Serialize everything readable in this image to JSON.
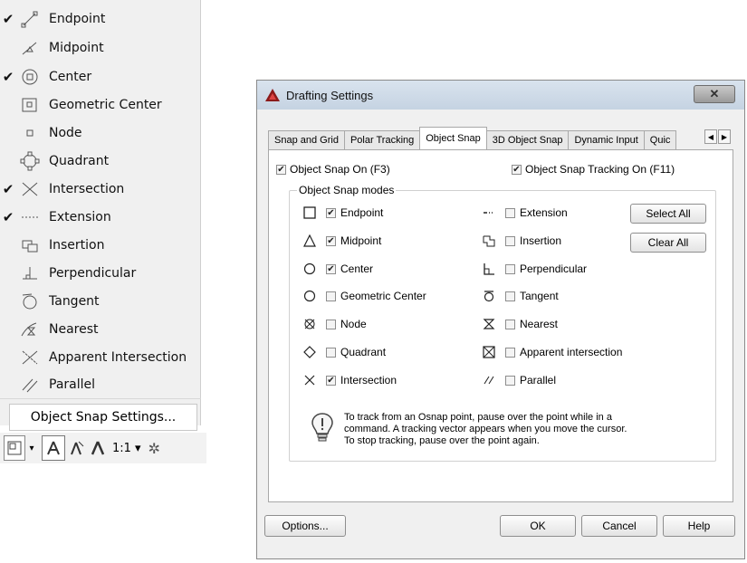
{
  "snap_menu": {
    "items": [
      {
        "label": "Endpoint",
        "checked": true,
        "icon": "endpoint-icon"
      },
      {
        "label": "Midpoint",
        "checked": false,
        "icon": "midpoint-icon"
      },
      {
        "label": "Center",
        "checked": true,
        "icon": "center-icon"
      },
      {
        "label": "Geometric Center",
        "checked": false,
        "icon": "geometric-center-icon"
      },
      {
        "label": "Node",
        "checked": false,
        "icon": "node-icon"
      },
      {
        "label": "Quadrant",
        "checked": false,
        "icon": "quadrant-icon"
      },
      {
        "label": "Intersection",
        "checked": true,
        "icon": "intersection-icon"
      },
      {
        "label": "Extension",
        "checked": true,
        "icon": "extension-icon"
      },
      {
        "label": "Insertion",
        "checked": false,
        "icon": "insertion-icon"
      },
      {
        "label": "Perpendicular",
        "checked": false,
        "icon": "perpendicular-icon"
      },
      {
        "label": "Tangent",
        "checked": false,
        "icon": "tangent-icon"
      },
      {
        "label": "Nearest",
        "checked": false,
        "icon": "nearest-icon"
      },
      {
        "label": "Apparent Intersection",
        "checked": false,
        "icon": "apparent-intersection-icon"
      },
      {
        "label": "Parallel",
        "checked": false,
        "icon": "parallel-icon"
      }
    ],
    "check_glyph": "✔",
    "settings_label": "Object Snap Settings..."
  },
  "status_toolbar": {
    "scale_label": "1:1 ▾",
    "dropdown_glyph": "▾"
  },
  "dialog": {
    "title": "Drafting Settings",
    "close_glyph": "✕",
    "tabs": [
      {
        "label": "Snap and Grid",
        "active": false
      },
      {
        "label": "Polar Tracking",
        "active": false
      },
      {
        "label": "Object Snap",
        "active": true
      },
      {
        "label": "3D Object Snap",
        "active": false
      },
      {
        "label": "Dynamic Input",
        "active": false
      },
      {
        "label": "Quic",
        "active": false
      }
    ],
    "tab_scroll_left": "◀",
    "tab_scroll_right": "▶",
    "snap_on_label": "Object Snap On (F3)",
    "snap_on_checked": true,
    "tracking_label": "Object Snap Tracking On (F11)",
    "tracking_checked": true,
    "modes_legend": "Object Snap modes",
    "modes_left": [
      {
        "label": "Endpoint",
        "checked": true,
        "symbol": "square-symbol"
      },
      {
        "label": "Midpoint",
        "checked": true,
        "symbol": "triangle-symbol"
      },
      {
        "label": "Center",
        "checked": true,
        "symbol": "circle-symbol"
      },
      {
        "label": "Geometric Center",
        "checked": false,
        "symbol": "circle-symbol"
      },
      {
        "label": "Node",
        "checked": false,
        "symbol": "node-symbol"
      },
      {
        "label": "Quadrant",
        "checked": false,
        "symbol": "diamond-symbol"
      },
      {
        "label": "Intersection",
        "checked": true,
        "symbol": "x-symbol"
      }
    ],
    "modes_right": [
      {
        "label": "Extension",
        "checked": false,
        "symbol": "extension-symbol"
      },
      {
        "label": "Insertion",
        "checked": false,
        "symbol": "insertion-symbol"
      },
      {
        "label": "Perpendicular",
        "checked": false,
        "symbol": "perpendicular-symbol"
      },
      {
        "label": "Tangent",
        "checked": false,
        "symbol": "tangent-symbol"
      },
      {
        "label": "Nearest",
        "checked": false,
        "symbol": "nearest-symbol"
      },
      {
        "label": "Apparent intersection",
        "checked": false,
        "symbol": "apparent-intersection-symbol"
      },
      {
        "label": "Parallel",
        "checked": false,
        "symbol": "parallel-symbol"
      }
    ],
    "select_all_label": "Select All",
    "clear_all_label": "Clear All",
    "hint_lines": [
      "To track from an Osnap point, pause over the point while in a",
      "command.  A tracking vector appears when you move the cursor.",
      "To stop tracking, pause over the point again."
    ],
    "options_label": "Options...",
    "ok_label": "OK",
    "cancel_label": "Cancel",
    "help_label": "Help"
  }
}
